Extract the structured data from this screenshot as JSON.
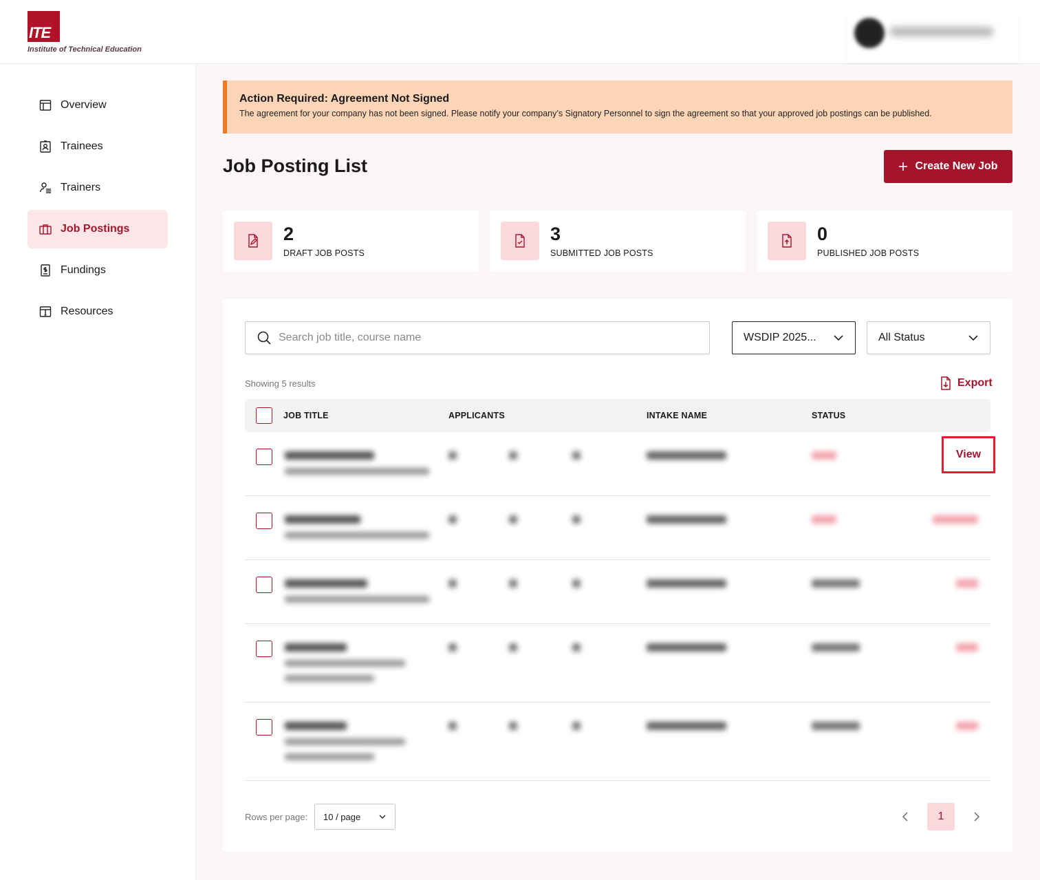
{
  "brand": {
    "logo_text": "ITE",
    "subtitle": "Institute of Technical Education",
    "color": "#a4152c"
  },
  "sidebar": {
    "items": [
      {
        "label": "Overview",
        "icon": "layout-icon",
        "active": false
      },
      {
        "label": "Trainees",
        "icon": "id-badge-icon",
        "active": false
      },
      {
        "label": "Trainers",
        "icon": "user-list-icon",
        "active": false
      },
      {
        "label": "Job Postings",
        "icon": "briefcase-icon",
        "active": true
      },
      {
        "label": "Fundings",
        "icon": "receipt-dollar-icon",
        "active": false
      },
      {
        "label": "Resources",
        "icon": "info-calendar-icon",
        "active": false
      }
    ]
  },
  "alert": {
    "title": "Action Required: Agreement Not Signed",
    "body": "The agreement for your company has not been signed. Please notify your company’s Signatory Personnel to sign the agreement so that your approved job postings can be published."
  },
  "page": {
    "title": "Job Posting List",
    "create_label": "Create New Job"
  },
  "stats": [
    {
      "value": "2",
      "label": "DRAFT JOB POSTS",
      "icon": "file-edit-icon"
    },
    {
      "value": "3",
      "label": "SUBMITTED JOB POSTS",
      "icon": "file-check-icon"
    },
    {
      "value": "0",
      "label": "PUBLISHED JOB POSTS",
      "icon": "file-upload-icon"
    }
  ],
  "filters": {
    "search_placeholder": "Search job title, course name",
    "intake": "WSDIP 2025...",
    "status": "All Status"
  },
  "results": {
    "showing": "Showing 5 results",
    "export_label": "Export"
  },
  "table": {
    "columns": [
      "JOB TITLE",
      "APPLICANTS",
      "INTAKE NAME",
      "STATUS"
    ],
    "first_row_action": "View"
  },
  "pagination": {
    "rows_label": "Rows per page:",
    "rows_value": "10 / page",
    "current_page": "1"
  }
}
